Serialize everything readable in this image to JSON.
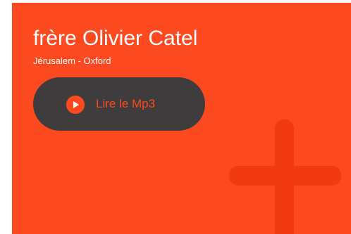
{
  "card": {
    "title": "frère Olivier Catel",
    "subtitle": "Jérusalem - Oxford",
    "background_color": "#fd4920",
    "decoration_icon": "cross-icon"
  },
  "player": {
    "button_label": "Lire le Mp3",
    "icon": "play-icon",
    "button_color": "#3f3c3d",
    "accent_color": "#fd4920"
  }
}
